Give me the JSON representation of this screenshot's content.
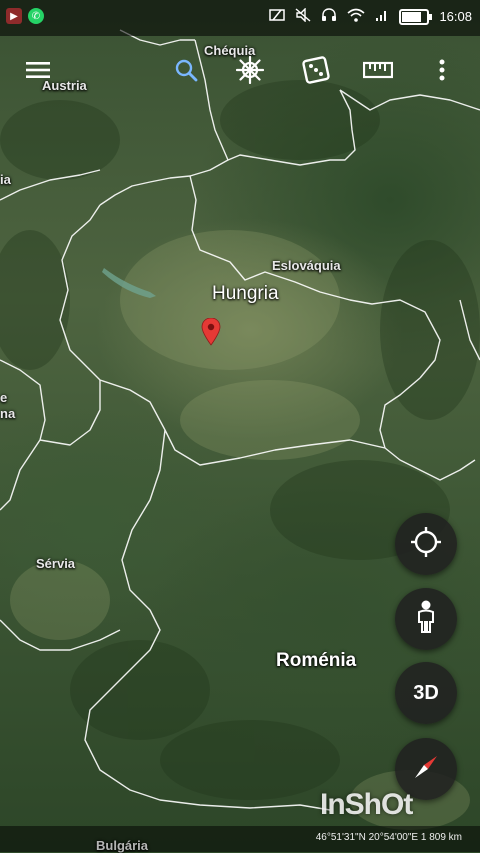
{
  "status_bar": {
    "left_apps": [
      "video-app-icon",
      "whatsapp-icon"
    ],
    "right_icons": [
      "screen-cast-icon",
      "mute-icon",
      "headset-icon",
      "wifi-icon",
      "signal-icon",
      "battery-icon"
    ],
    "battery_level": 0.85,
    "time": "16:08"
  },
  "toolbar": {
    "menu_icon": "menu-icon",
    "search_icon": "search-icon",
    "voyager_icon": "ships-wheel-icon",
    "feeling_lucky_icon": "dice-icon",
    "measure_icon": "ruler-icon",
    "overflow_icon": "more-vert-icon"
  },
  "map": {
    "labels": {
      "chequia": "Chéquia",
      "austria": "Austria",
      "left_edge_1": "ia",
      "eslovaquia": "Eslováquia",
      "hungria": "Hungria",
      "left_edge_2": "e\nna",
      "servia": "Sérvia",
      "romenia": "Roménia",
      "bulgaria": "Bulgária"
    },
    "pin_icon": "map-pin-icon",
    "colors": {
      "border": "#ffffff",
      "pin": "#e53935",
      "search_accent": "#7ab7ff"
    }
  },
  "controls": {
    "my_location_icon": "my-location-icon",
    "street_view_icon": "pegman-icon",
    "threed_label": "3D",
    "compass_icon": "compass-icon"
  },
  "watermark": "InShOt",
  "coordinates": "46°51'31\"N 20°54'00\"E 1 809 km"
}
